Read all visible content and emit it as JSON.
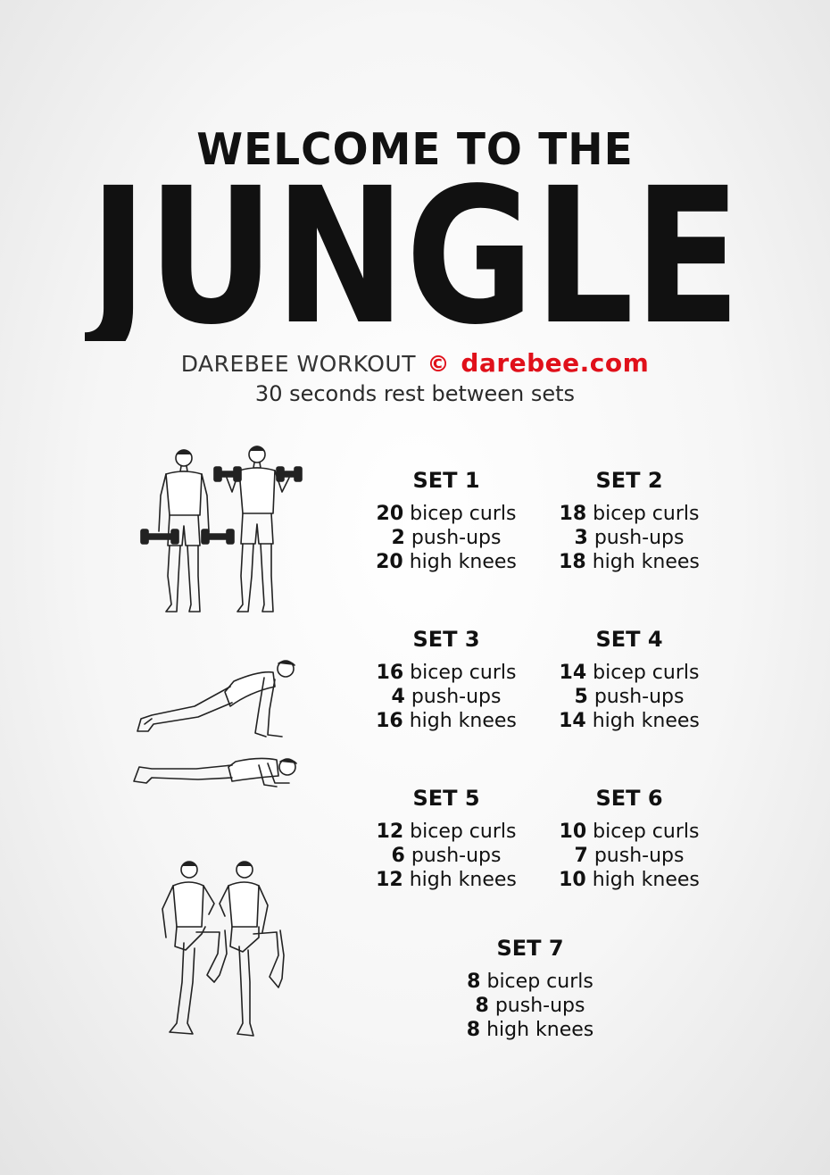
{
  "header": {
    "title_top": "WELCOME TO THE",
    "title_main": "JUNGLE",
    "credit_label": "DAREBEE WORKOUT",
    "copyright_symbol": "©",
    "site": "darebee.com",
    "rest_note": "30 seconds rest between sets"
  },
  "sets": [
    {
      "title": "SET 1",
      "exercises": [
        {
          "count": "20",
          "name": "bicep curls"
        },
        {
          "count": "2",
          "name": "push-ups"
        },
        {
          "count": "20",
          "name": "high knees"
        }
      ]
    },
    {
      "title": "SET 2",
      "exercises": [
        {
          "count": "18",
          "name": "bicep curls"
        },
        {
          "count": "3",
          "name": "push-ups"
        },
        {
          "count": "18",
          "name": "high knees"
        }
      ]
    },
    {
      "title": "SET 3",
      "exercises": [
        {
          "count": "16",
          "name": "bicep curls"
        },
        {
          "count": "4",
          "name": "push-ups"
        },
        {
          "count": "16",
          "name": "high knees"
        }
      ]
    },
    {
      "title": "SET 4",
      "exercises": [
        {
          "count": "14",
          "name": "bicep curls"
        },
        {
          "count": "5",
          "name": "push-ups"
        },
        {
          "count": "14",
          "name": "high knees"
        }
      ]
    },
    {
      "title": "SET 5",
      "exercises": [
        {
          "count": "12",
          "name": "bicep curls"
        },
        {
          "count": "6",
          "name": "push-ups"
        },
        {
          "count": "12",
          "name": "high knees"
        }
      ]
    },
    {
      "title": "SET 6",
      "exercises": [
        {
          "count": "10",
          "name": "bicep curls"
        },
        {
          "count": "7",
          "name": "push-ups"
        },
        {
          "count": "10",
          "name": "high knees"
        }
      ]
    },
    {
      "title": "SET 7",
      "exercises": [
        {
          "count": "8",
          "name": "bicep curls"
        },
        {
          "count": "8",
          "name": "push-ups"
        },
        {
          "count": "8",
          "name": "high knees"
        }
      ]
    }
  ],
  "illustrations": [
    "bicep-curl-figure",
    "push-up-figure",
    "high-knees-figure"
  ],
  "colors": {
    "accent": "#e0101a",
    "text": "#111111"
  }
}
